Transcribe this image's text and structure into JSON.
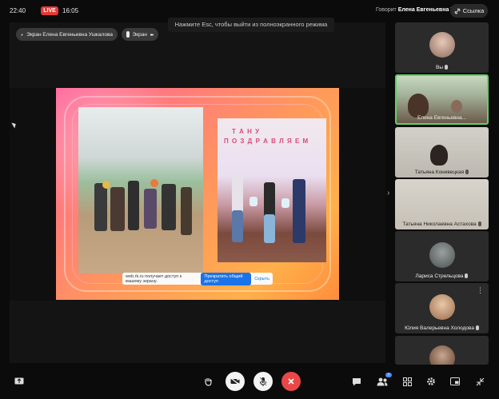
{
  "topbar": {
    "time": "22:40",
    "live_label": "LIVE",
    "duration": "16:05",
    "speaking_prefix": "Говорит",
    "speaking_name": "Елена Евгеньевна У.",
    "link_label": "Ссылка"
  },
  "toast": {
    "text": "Нажмите Esc, чтобы выйти из полноэкранного режима"
  },
  "pills": {
    "screen_owner": "Экран Елена Евгеньевна Ушкалова",
    "screen_label": "Экран"
  },
  "slide": {
    "banner_line1": "Т А Н У",
    "banner_line2": "П О З Д Р А В Л Я Е М",
    "share_text": "web.rk.ru получает доступ к вашему экрану.",
    "stop_label": "Прекратить общий доступ",
    "hide_label": "Скрыть"
  },
  "participants": [
    {
      "name": "Вы"
    },
    {
      "name": "Елена Евгеньевна..."
    },
    {
      "name": "Татьяна Конивецкая"
    },
    {
      "name": "Татьяна Николаевна Астахова"
    },
    {
      "name": "Лариса Стрельцова"
    },
    {
      "name": "Юлия Валерьевна Холодова"
    },
    {
      "name": ""
    }
  ],
  "toolbar": {
    "participants_count": "7"
  },
  "colors": {
    "live": "#e53935",
    "active_border": "#5fd068",
    "end_call": "#e84848",
    "primary": "#1a73e8"
  }
}
